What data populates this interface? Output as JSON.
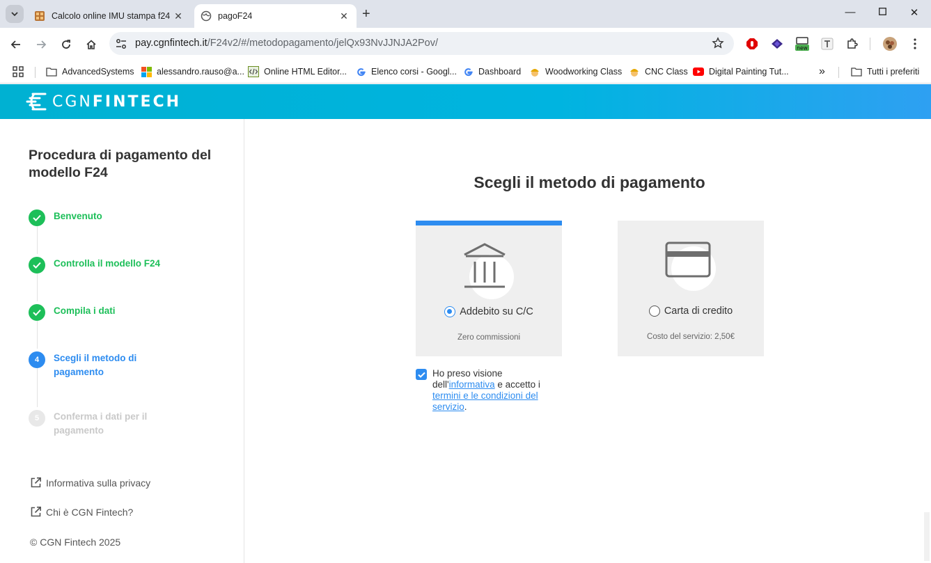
{
  "browser": {
    "tabs": [
      {
        "title": "Calcolo online IMU stampa f24",
        "active": false
      },
      {
        "title": "pagoF24",
        "active": true
      }
    ],
    "url_host": "pay.cgnfintech.it",
    "url_path": "/F24v2/#/metodopagamento/jelQx93NvJJNJA2Pov/",
    "new_badge": "new",
    "bookmarks": [
      "AdvancedSystems",
      "alessandro.rauso@a...",
      "Online HTML Editor...",
      "Elenco corsi - Googl...",
      "Dashboard",
      "Woodworking Class",
      "CNC Class",
      "Digital Painting Tut..."
    ],
    "all_bookmarks": "Tutti i preferiti",
    "overflow": "»"
  },
  "brand": {
    "logo_light": "CGN",
    "logo_bold": "FINTECH"
  },
  "sidebar": {
    "title": "Procedura di pagamento del modello F24",
    "steps": [
      {
        "num": "1",
        "label": "Benvenuto",
        "state": "done"
      },
      {
        "num": "2",
        "label": "Controlla il modello F24",
        "state": "done"
      },
      {
        "num": "3",
        "label": "Compila i dati",
        "state": "done"
      },
      {
        "num": "4",
        "label": "Scegli il metodo di pagamento",
        "state": "current"
      },
      {
        "num": "5",
        "label": "Conferma i dati per il pagamento",
        "state": "todo"
      }
    ],
    "links": [
      "Informativa sulla privacy",
      "Chi è CGN Fintech?"
    ],
    "copyright": "© CGN Fintech 2025"
  },
  "main": {
    "title": "Scegli il metodo di pagamento",
    "options": [
      {
        "label": "Addebito su C/C",
        "note": "Zero commissioni",
        "selected": true,
        "icon": "bank-icon"
      },
      {
        "label": "Carta di credito",
        "note": "Costo del servizio: 2,50€",
        "selected": false,
        "icon": "credit-card-icon"
      }
    ],
    "consent": {
      "checked": true,
      "text_1": "Ho preso visione dell'",
      "link_1": "informativa",
      "text_2": " e accetto i ",
      "link_2": "termini e le condizioni del servizio",
      "text_3": "."
    }
  },
  "colors": {
    "accent": "#2d8cf0",
    "done": "#1dbf59",
    "brand_start": "#00b1d2",
    "brand_end": "#2ea0f2"
  }
}
